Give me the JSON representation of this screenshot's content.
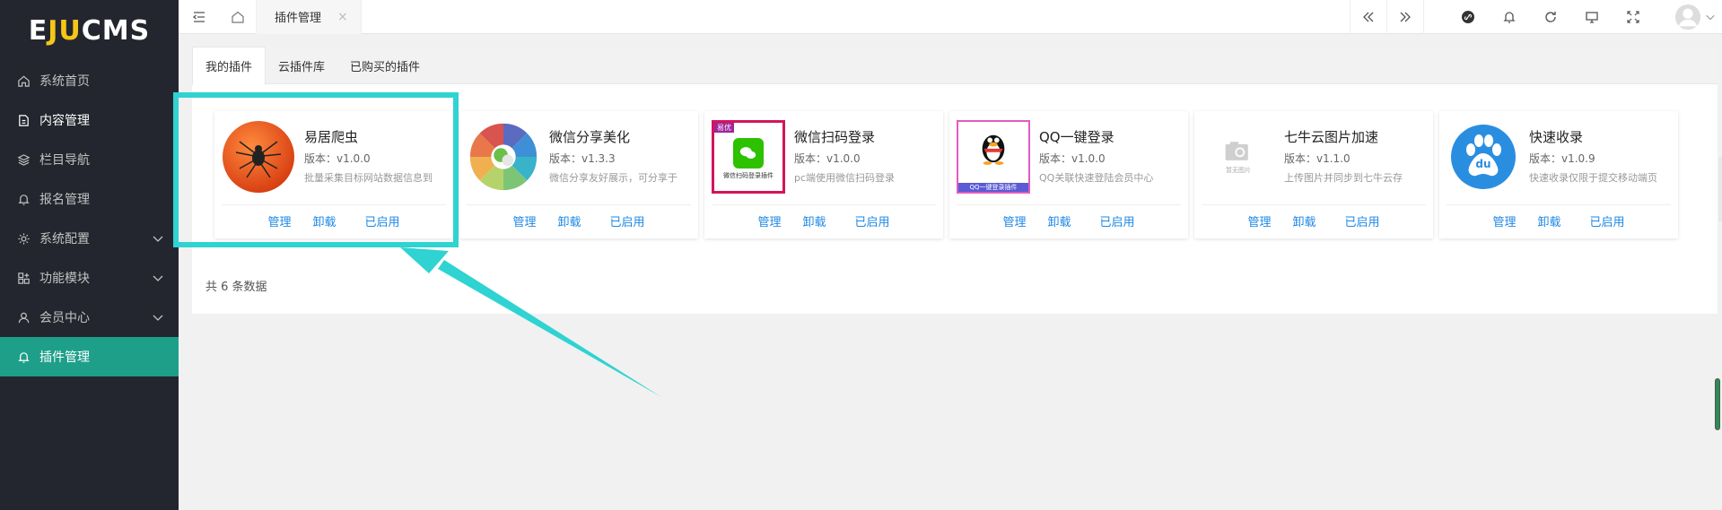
{
  "sidebar": {
    "logo": {
      "prefix": "E",
      "mid": "JU",
      "suffix": "CMS"
    },
    "items": [
      {
        "label": "系统首页",
        "icon": "home-icon"
      },
      {
        "label": "内容管理",
        "icon": "document-icon"
      },
      {
        "label": "栏目导航",
        "icon": "layers-icon"
      },
      {
        "label": "报名管理",
        "icon": "bell-icon"
      },
      {
        "label": "系统配置",
        "icon": "gear-icon"
      },
      {
        "label": "功能模块",
        "icon": "modules-icon"
      },
      {
        "label": "会员中心",
        "icon": "user-icon"
      },
      {
        "label": "插件管理",
        "icon": "bell-icon"
      }
    ]
  },
  "topbar": {
    "active_tab": "插件管理",
    "close_glyph": "×",
    "icons": [
      "menu-fold-icon",
      "home-icon",
      "prev-icon",
      "next-icon",
      "link-icon",
      "bell-icon",
      "refresh-icon",
      "monitor-icon",
      "fullscreen-icon",
      "avatar-icon"
    ]
  },
  "subtabs": [
    "我的插件",
    "云插件库",
    "已购买的插件"
  ],
  "plugins": [
    {
      "name": "易居爬虫",
      "version": "版本：v1.0.0",
      "desc": "批量采集目标网站数据信息到",
      "icon": "spider-icon"
    },
    {
      "name": "微信分享美化",
      "version": "版本：v1.3.3",
      "desc": "微信分享友好展示，可分享于",
      "icon": "wechat-share-icon"
    },
    {
      "name": "微信扫码登录",
      "version": "版本：v1.0.0",
      "desc": "pc端使用微信扫码登录",
      "icon": "wechat-login-icon",
      "badge": "易优",
      "caption": "微信扫码登录插件"
    },
    {
      "name": "QQ一键登录",
      "version": "版本：v1.0.0",
      "desc": "QQ关联快速登陆会员中心",
      "icon": "qq-icon",
      "caption": "QQ一键登录插件"
    },
    {
      "name": "七牛云图片加速",
      "version": "版本：v1.1.0",
      "desc": "上传图片并同步到七牛云存",
      "icon": "no-image-icon",
      "caption": "暂无图片"
    },
    {
      "name": "快速收录",
      "version": "版本：v1.0.9",
      "desc": "快速收录仅限于提交移动端页",
      "icon": "baidu-paw-icon",
      "caption": "du"
    }
  ],
  "actions": {
    "manage": "管理",
    "uninstall": "卸载",
    "enabled": "已启用"
  },
  "total": "共 6 条数据",
  "colors": {
    "sidebar_bg": "#23262e",
    "active_green": "#1e9f8a",
    "link_blue": "#1e88e5",
    "highlight": "#2fd3d1"
  }
}
